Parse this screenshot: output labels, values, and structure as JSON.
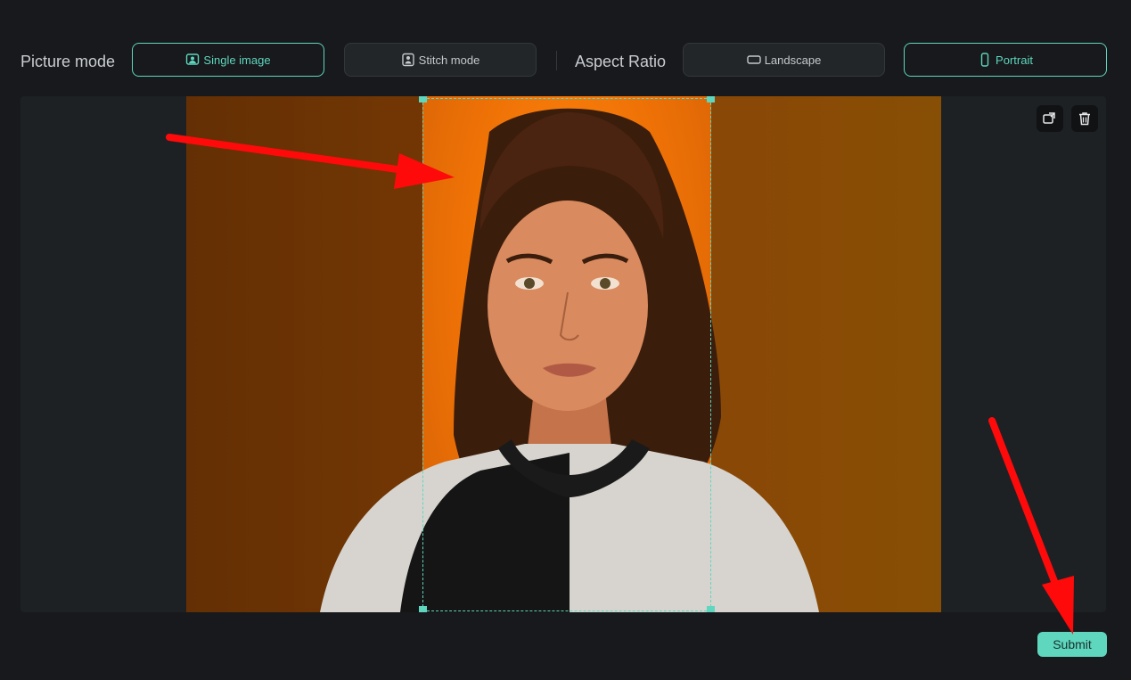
{
  "picture_mode": {
    "label": "Picture mode",
    "options": [
      {
        "label": "Single image",
        "icon": "portrait-photo-icon",
        "active": true
      },
      {
        "label": "Stitch mode",
        "icon": "stitch-icon",
        "active": false
      }
    ]
  },
  "aspect_ratio": {
    "label": "Aspect Ratio",
    "options": [
      {
        "label": "Landscape",
        "icon": "landscape-icon",
        "active": false
      },
      {
        "label": "Portrait",
        "icon": "portrait-icon",
        "active": true
      }
    ]
  },
  "canvas": {
    "tools": [
      {
        "name": "replace-image-icon"
      },
      {
        "name": "trash-icon"
      }
    ],
    "image": "portrait photo of a woman against an orange background",
    "crop_selection": "portrait"
  },
  "submit_label": "Submit",
  "annotations": {
    "arrow_color": "#ff0a0a"
  },
  "colors": {
    "accent": "#5fd6be",
    "background": "#17191c"
  }
}
